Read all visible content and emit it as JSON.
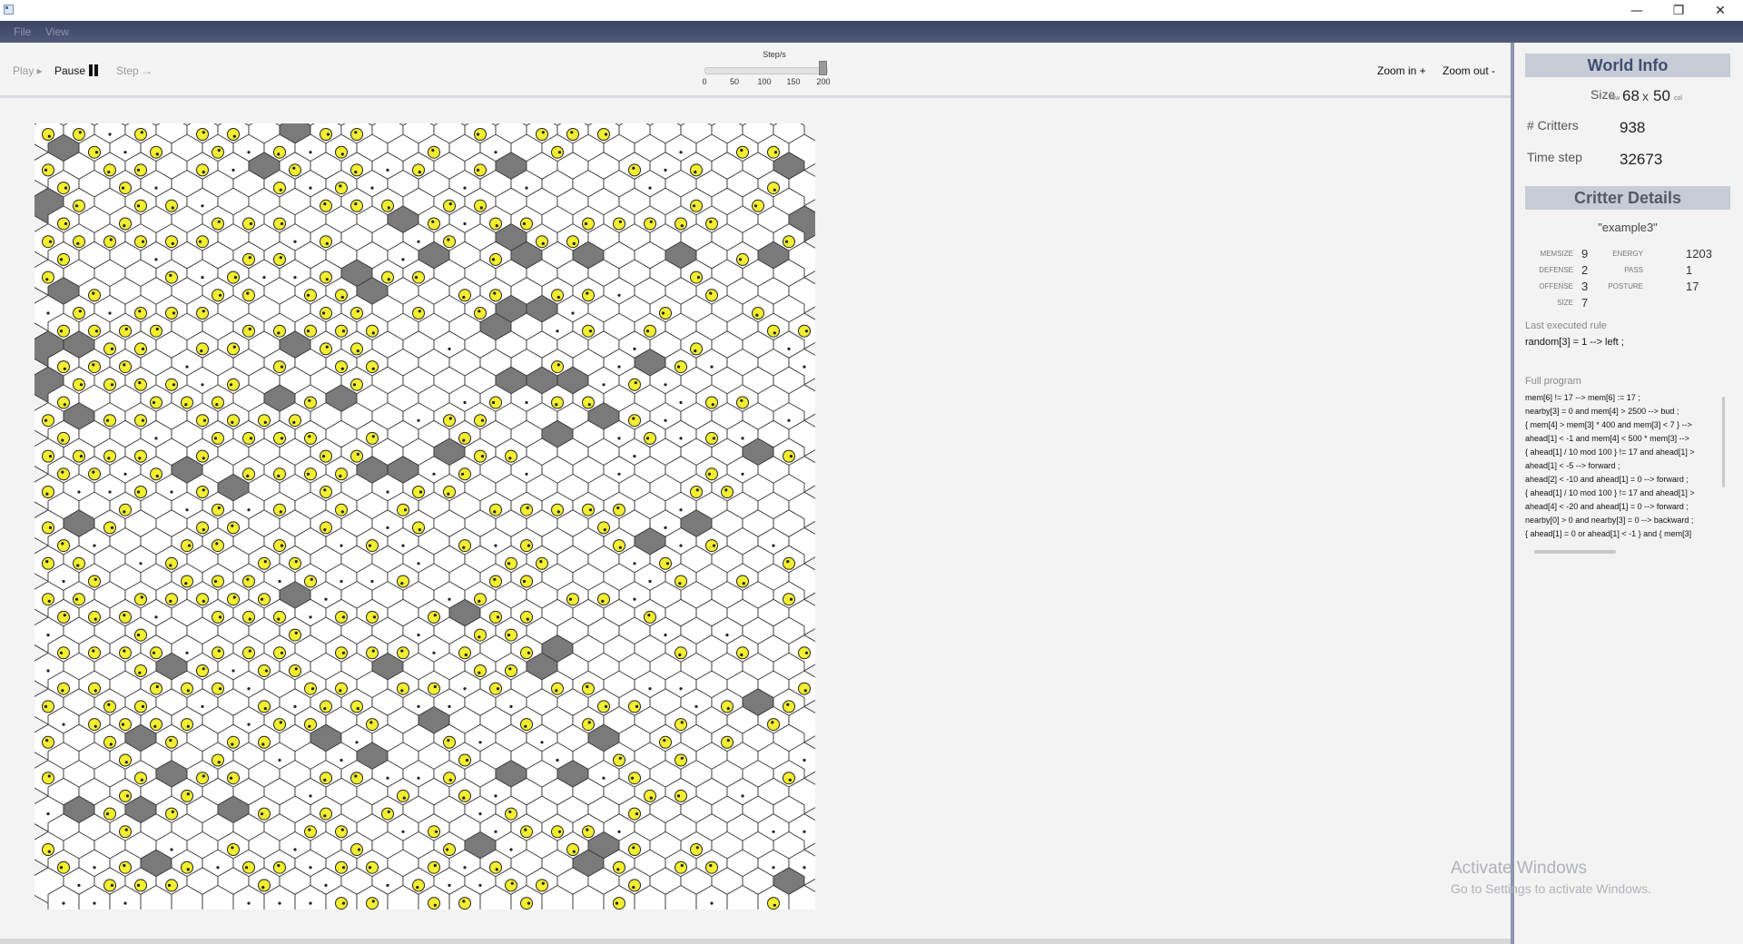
{
  "window": {
    "minimize_glyph": "—",
    "maximize_glyph": "❐",
    "close_glyph": "✕"
  },
  "menu": {
    "file": "File",
    "view": "View"
  },
  "toolbar": {
    "play": "Play ▸",
    "pause": "Pause",
    "step": "Step →",
    "speed_label": "Step/s",
    "speed_ticks": [
      "0",
      "50",
      "100",
      "150",
      "200"
    ],
    "speed_value": 200,
    "zoom_in": "Zoom in +",
    "zoom_out": "Zoom out -"
  },
  "world": {
    "rows": 68,
    "cols": 50
  },
  "world_info": {
    "title": "World Info",
    "size_label": "Size",
    "size_row_label": "row",
    "size_rows": "68",
    "size_x": "x",
    "size_cols": "50",
    "size_col_label": "col",
    "critters_label": "# Critters",
    "critters": "938",
    "timestep_label": "Time step",
    "timestep": "32673"
  },
  "critter": {
    "title": "Critter Details",
    "name": "\"example3\"",
    "memsize_label": "MEMSIZE",
    "memsize": "9",
    "defense_label": "DEFENSE",
    "defense": "2",
    "offense_label": "OFFENSE",
    "offense": "3",
    "size_label": "SIZE",
    "size": "7",
    "energy_label": "ENERGY",
    "energy": "1203",
    "pass_label": "PASS",
    "pass": "1",
    "posture_label": "POSTURE",
    "posture": "17",
    "last_rule_label": "Last executed rule",
    "last_rule": "random[3] = 1 --> left ;",
    "program_label": "Full program",
    "program": [
      "mem[6] != 17 --> mem[6] := 17 ;",
      "nearby[3] = 0 and mem[4] > 2500 --> bud ;",
      "{ mem[4] > mem[3] * 400 and mem[3] < 7 } -->",
      "ahead[1] < -1 and mem[4] < 500 * mem[3] -->",
      "{ ahead[1] / 10 mod 100 } != 17 and ahead[1] >",
      "ahead[1] < -5 --> forward ;",
      "ahead[2] < -10 and ahead[1] = 0 --> forward ;",
      "{ ahead[1] / 10 mod 100 } != 17 and ahead[1] >",
      "ahead[4] < -20 and ahead[1] = 0 --> forward ;",
      "nearby[0] > 0 and nearby[3] = 0 --> backward ;",
      "{ ahead[1] = 0 or ahead[1] < -1 } and { mem[3]"
    ]
  },
  "watermark": {
    "title": "Activate Windows",
    "subtitle": "Go to Settings to activate Windows."
  },
  "colors": {
    "menubar": "#454b6e",
    "rock": "#7a7a7a",
    "critter": "#f2ee30",
    "divider": "#8d96b2"
  },
  "icons": {
    "critter": "critter-icon",
    "food": "food-icon",
    "rock": "rock-hex",
    "pause": "pause-icon"
  }
}
